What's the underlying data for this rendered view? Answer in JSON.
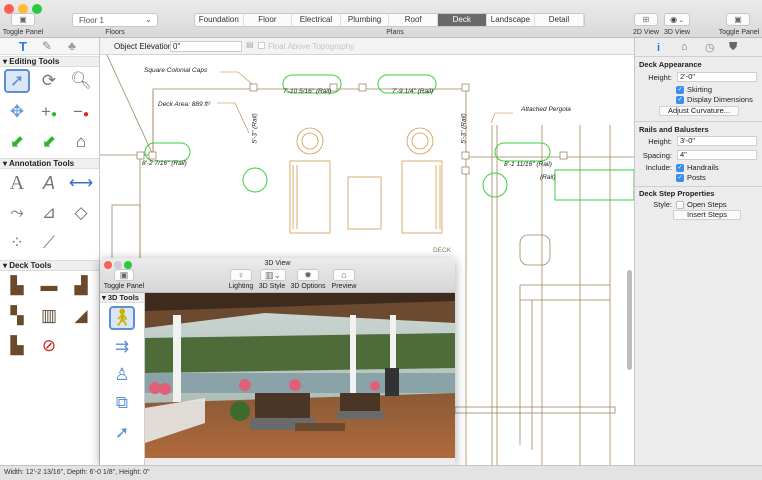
{
  "toolbar": {
    "toggle_panel_left": "Toggle Panel",
    "floor_value": "Floor 1",
    "floors_label": "Floors",
    "plans": [
      "Foundation",
      "Floor",
      "Electrical",
      "Plumbing",
      "Roof",
      "Deck",
      "Landscape",
      "Detail"
    ],
    "selected_plan": "Deck",
    "plans_label": "Plans",
    "view_2d": "2D View",
    "view_3d": "3D View",
    "toggle_panel_right": "Toggle Panel"
  },
  "left_panel": {
    "sections": [
      {
        "title": "Editing Tools",
        "tools": [
          "select",
          "rotate",
          "zoom",
          "move",
          "add-point",
          "remove-point",
          "extend-corner",
          "trim-corner",
          "house-split"
        ]
      },
      {
        "title": "Annotation Tools",
        "tools": [
          "text",
          "text-rotated",
          "dimension",
          "dimension-line",
          "dimension-angle",
          "dimension-box",
          "radial-dimension",
          "callout"
        ]
      },
      {
        "title": "Deck Tools",
        "tools": [
          "deck-railing",
          "deck-platform",
          "deck-pergola",
          "deck-bench",
          "deck-fence",
          "deck-stairs",
          "deck-steps",
          "no-deck"
        ]
      }
    ]
  },
  "options": {
    "object_elevation_label": "Object Elevation:",
    "object_elevation_value": "0\"",
    "float_label": "Float Above Topography"
  },
  "plan": {
    "labels": {
      "caps": "Square Colonial Caps",
      "area": "Deck Area: 889 ft²",
      "pergola": "Attached Pergola",
      "deck": "DECK"
    },
    "dims": [
      "7'-10 5/16\" (Rail)",
      "7'-9 1/4\" (Rail)",
      "5'-3\" (Rail)",
      "5'-3\" (Rail)",
      "8'-2 7/16\" (Rail)",
      "8'-1 11/16\" (Rail)",
      "(Rail)"
    ]
  },
  "right_panel": {
    "deck_appearance": {
      "title": "Deck Appearance",
      "height_label": "Height:",
      "height_value": "2'-0\"",
      "skirting": "Skirting",
      "display_dimensions": "Display Dimensions",
      "adjust_button": "Adjust Curvature..."
    },
    "rails": {
      "title": "Rails and Balusters",
      "height_label": "Height:",
      "height_value": "3'-0\"",
      "spacing_label": "Spacing:",
      "spacing_value": "4\"",
      "include_label": "Include:",
      "handrails": "Handrails",
      "posts": "Posts"
    },
    "steps": {
      "title": "Deck Step Properties",
      "style_label": "Style:",
      "open_steps": "Open Steps",
      "insert_button": "Insert Steps"
    }
  },
  "view3d": {
    "title": "3D View",
    "toggle_panel": "Toggle Panel",
    "lighting": "Lighting",
    "style": "3D Style",
    "options": "3D Options",
    "preview": "Preview",
    "tools_title": "3D Tools"
  },
  "status": "Width: 12'-2 13/16\", Depth: 6'-0 1/8\", Height: 0\""
}
